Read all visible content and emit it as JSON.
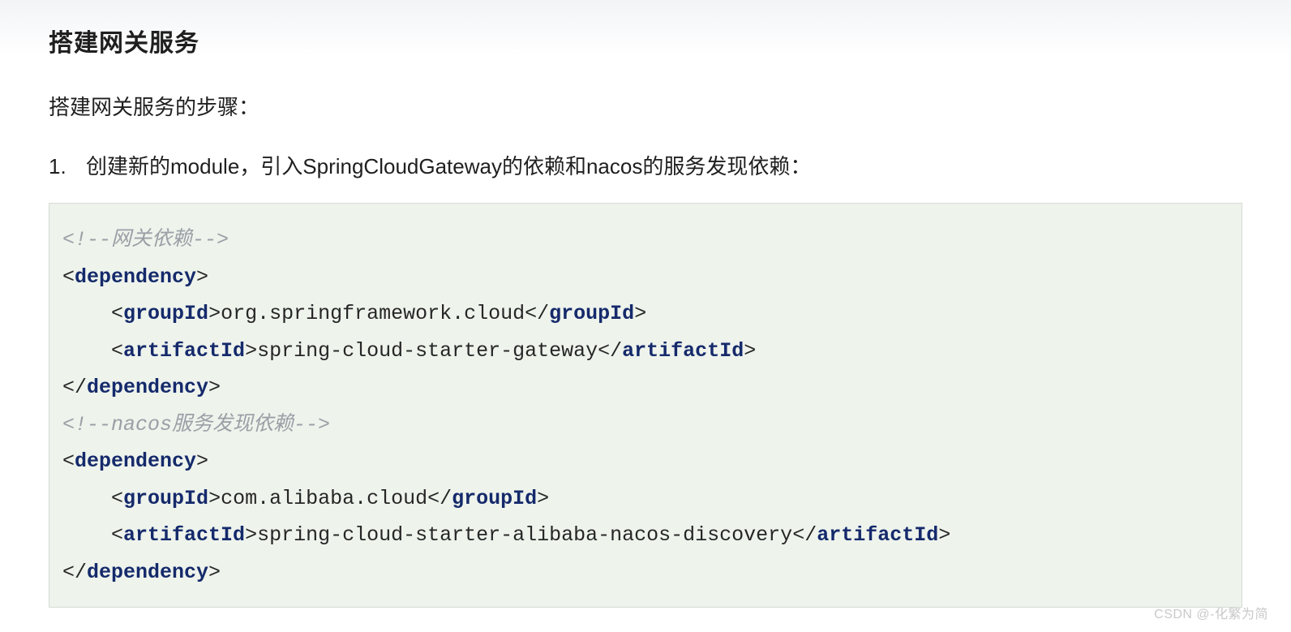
{
  "header": {
    "title": "搭建网关服务"
  },
  "intro": "搭建网关服务的步骤：",
  "step1": {
    "num": "1.",
    "text": "创建新的module，引入SpringCloudGateway的依赖和nacos的服务发现依赖："
  },
  "code": {
    "comment1": "<!--网关依赖-->",
    "dep1": {
      "open": "dependency",
      "groupId_tag": "groupId",
      "groupId_val": "org.springframework.cloud",
      "artifactId_tag": "artifactId",
      "artifactId_val": "spring-cloud-starter-gateway",
      "close": "dependency"
    },
    "comment2": "<!--nacos服务发现依赖-->",
    "dep2": {
      "open": "dependency",
      "groupId_tag": "groupId",
      "groupId_val": "com.alibaba.cloud",
      "artifactId_tag": "artifactId",
      "artifactId_val": "spring-cloud-starter-alibaba-nacos-discovery",
      "close": "dependency"
    }
  },
  "watermark": "CSDN @-化繁为简"
}
